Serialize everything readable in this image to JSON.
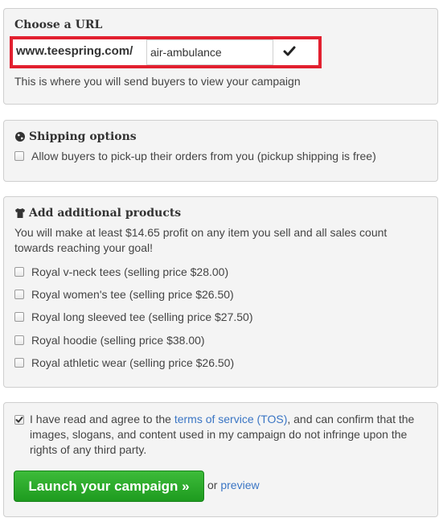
{
  "url_section": {
    "title": "Choose a URL",
    "prefix": "www.teespring.com/",
    "value": "air-ambulance",
    "help": "This is where you will send buyers to view your campaign"
  },
  "shipping": {
    "title": "Shipping options",
    "pickup_label": "Allow buyers to pick-up their orders from you (pickup shipping is free)",
    "pickup_checked": false
  },
  "products": {
    "title": "Add additional products",
    "intro_line1": "You will make at least $14.65 profit on any item you sell and all sales count",
    "intro_line2": "towards reaching your goal!",
    "items": [
      {
        "label": "Royal v-neck tees (selling price $28.00)",
        "checked": false
      },
      {
        "label": "Royal women's tee (selling price $26.50)",
        "checked": false
      },
      {
        "label": "Royal long sleeved tee (selling price $27.50)",
        "checked": false
      },
      {
        "label": "Royal hoodie (selling price $38.00)",
        "checked": false
      },
      {
        "label": "Royal athletic wear (selling price $26.50)",
        "checked": false
      }
    ]
  },
  "agreement": {
    "checked": true,
    "text_before": "I have read and agree to the ",
    "tos_link": "terms of service (TOS)",
    "text_after": ", and can confirm that the images, slogans, and content used in my campaign do not infringe upon the rights of any third party.",
    "launch_label": "Launch your campaign »",
    "or_text": "or",
    "preview_link": "preview"
  },
  "colors": {
    "highlight": "#e2202f",
    "button_green": "#2aa82a",
    "link": "#3a75c4"
  },
  "icons": {
    "confirm": "checkmark-icon",
    "shipping": "globe-icon",
    "products": "tshirt-icon"
  }
}
